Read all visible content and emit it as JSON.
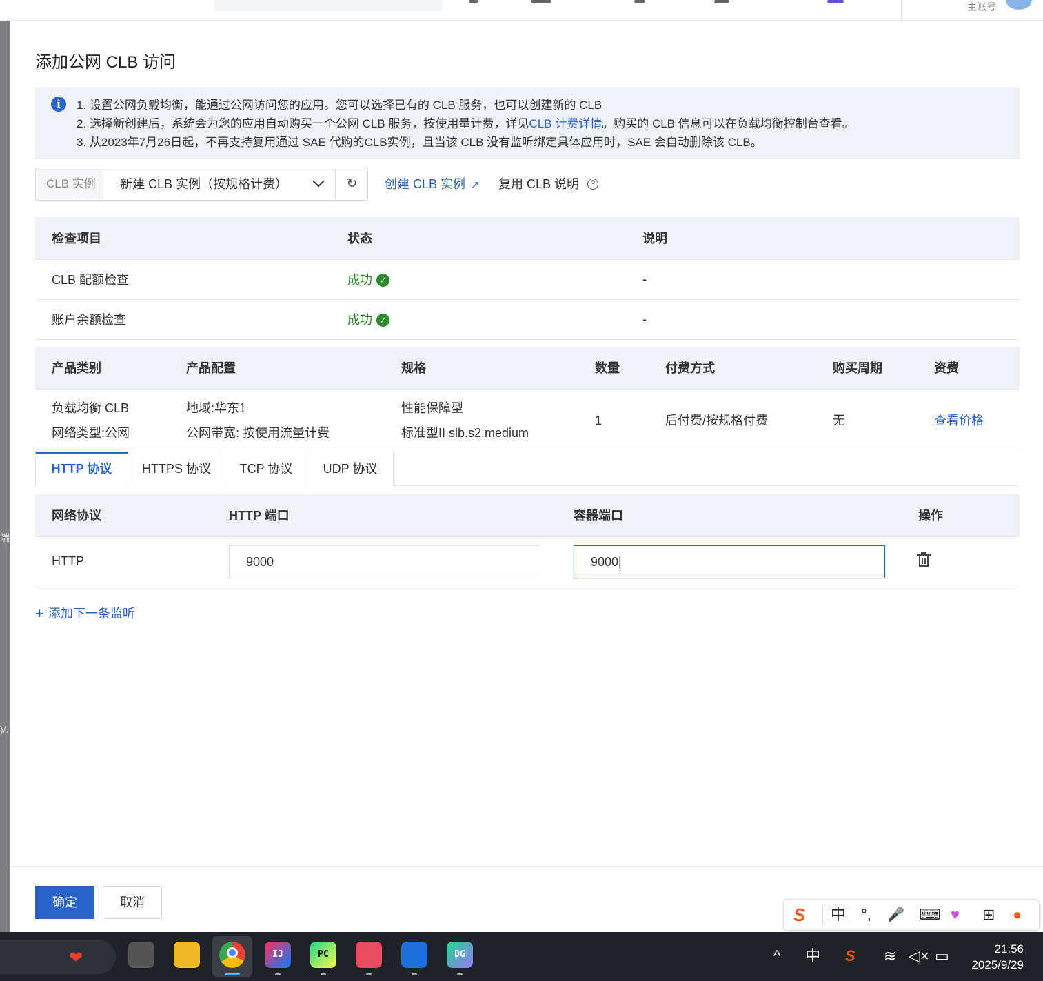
{
  "topbar": {
    "account_label": "主账号"
  },
  "left_hints": [
    "端",
    ")/."
  ],
  "modal": {
    "title": "添加公网 CLB 访问",
    "notice": {
      "line1": "1. 设置公网负载均衡，能通过公网访问您的应用。您可以选择已有的 CLB 服务，也可以创建新的 CLB",
      "line2_pre": "2. 选择新创建后，系统会为您的应用自动购买一个公网 CLB 服务，按使用量计费，详见",
      "line2_link": "CLB 计费详情",
      "line2_post": "。购买的 CLB 信息可以在负载均衡控制台查看。",
      "line3": "3. 从2023年7月26日起，不再支持复用通过 SAE 代购的CLB实例，且当该 CLB 没有监听绑定具体应用时，SAE 会自动删除该 CLB。"
    },
    "clb": {
      "label": "CLB 实例",
      "selected": "新建 CLB 实例（按规格计费）",
      "refresh_icon": "refresh-icon",
      "create_link": "创建 CLB 实例",
      "reuse_label": "复用 CLB 说明"
    },
    "check_table": {
      "headers": [
        "检查项目",
        "状态",
        "说明"
      ],
      "rows": [
        {
          "item": "CLB 配额检查",
          "status": "成功",
          "note": "-"
        },
        {
          "item": "账户余额检查",
          "status": "成功",
          "note": "-"
        }
      ]
    },
    "product_table": {
      "headers": [
        "产品类别",
        "产品配置",
        "规格",
        "数量",
        "付费方式",
        "购买周期",
        "资费"
      ],
      "row": {
        "category_1": "负载均衡 CLB",
        "category_2": "网络类型:公网",
        "config_1": "地域:华东1",
        "config_2": "公网带宽: 按使用流量计费",
        "spec_1": "性能保障型",
        "spec_2": "标准型II slb.s2.medium",
        "quantity": "1",
        "payment": "后付费/按规格付费",
        "period": "无",
        "price_link": "查看价格"
      }
    },
    "tabs": [
      "HTTP 协议",
      "HTTPS 协议",
      "TCP 协议",
      "UDP 协议"
    ],
    "active_tab": "HTTP 协议",
    "port_table": {
      "headers": [
        "网络协议",
        "HTTP 端口",
        "容器端口",
        "操作"
      ],
      "row": {
        "protocol": "HTTP",
        "http_port": "9000",
        "container_port": "9000"
      }
    },
    "add_next": "添加下一条监听",
    "buttons": {
      "ok": "确定",
      "cancel": "取消"
    }
  },
  "ime": {
    "logo": "S",
    "mode": "中",
    "punct": "°,",
    "mic": "🎙",
    "keyboard": "⌨",
    "apps": "⊞"
  },
  "taskbar": {
    "apps": [
      {
        "name": "IJ",
        "color": "#1b5fd1"
      },
      {
        "name": "PC",
        "color": "#21b15a"
      },
      {
        "name": "DG",
        "color": "#1d9b5e"
      }
    ],
    "tray_ime": "中",
    "time": "21:56",
    "date": "2025/9/29"
  },
  "colors": {
    "accent": "#2a63c9",
    "success": "#2c8a2c"
  }
}
